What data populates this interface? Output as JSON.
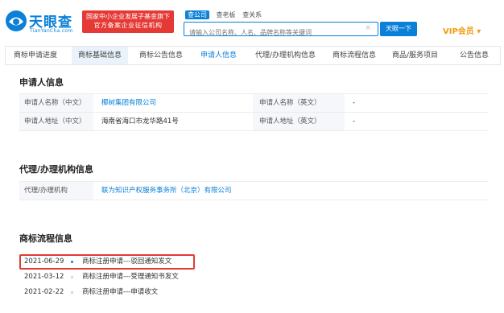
{
  "header": {
    "brand": "天眼查",
    "brand_url": "TianYanCha.com",
    "banner_line1": "国家中小企业发展子基金旗下",
    "banner_line2": "官方备案企业征信机构",
    "search_tabs": [
      "查公司",
      "查老板",
      "查关系"
    ],
    "search_placeholder": "请输入公司名称、人名、品牌名称等关键词",
    "search_clear": "×",
    "search_button": "天眼一下",
    "vip": "VIP会员 ▾"
  },
  "tabs": [
    "商标申请进度",
    "商标基础信息",
    "商标公告信息",
    "申请人信息",
    "代理/办理机构信息",
    "商标流程信息",
    "商品/服务项目",
    "公告信息"
  ],
  "applicant": {
    "title": "申请人信息",
    "rows": [
      {
        "label1": "申请人名称（中文）",
        "value1": "椰树集团有限公司",
        "label2": "申请人名称（英文）",
        "value2": "-"
      },
      {
        "label1": "申请人地址（中文）",
        "value1": "海南省海口市龙华路41号",
        "label2": "申请人地址（英文）",
        "value2": "-"
      }
    ]
  },
  "agency": {
    "title": "代理/办理机构信息",
    "label": "代理/办理机构",
    "value": "联为知识产权服务事务所（北京）有限公司"
  },
  "process": {
    "title": "商标流程信息",
    "items": [
      {
        "date": "2021-06-29",
        "text": "商标注册申请---驳回通知发文"
      },
      {
        "date": "2021-03-12",
        "text": "商标注册申请---受理通知书发文"
      },
      {
        "date": "2021-02-22",
        "text": "商标注册申请---申请收文"
      }
    ]
  },
  "colors": {
    "accent": "#0a80d8",
    "highlight": "#e53935",
    "vip": "#f39c12"
  }
}
